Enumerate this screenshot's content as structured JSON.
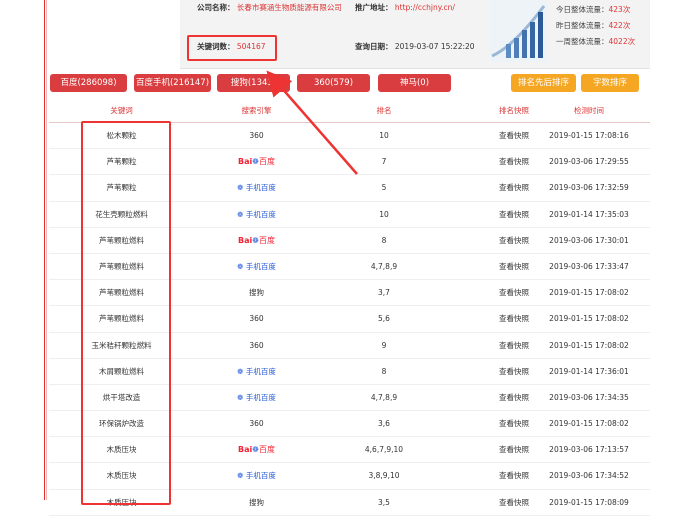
{
  "header": {
    "company_label": "公司名称：",
    "company_value": "长春市赛涵生物质能源有限公司",
    "promo_label": "推广地址：",
    "promo_value": "http://cchjny.cn/",
    "keywords_label": "关键词数：",
    "keywords_value": "504167",
    "query_label": "查询日期：",
    "query_value": "2019-03-07 15:22:20"
  },
  "stats": [
    {
      "label": "今日整体流量：",
      "value": "423次"
    },
    {
      "label": "昨日整体流量：",
      "value": "422次"
    },
    {
      "label": "一周整体流量：",
      "value": "4022次"
    }
  ],
  "tabs": [
    {
      "label": "百度(286098)"
    },
    {
      "label": "百度手机(216147)"
    },
    {
      "label": "搜狗(1343)"
    },
    {
      "label": "360(579)"
    },
    {
      "label": "神马(0)"
    }
  ],
  "sort_buttons": [
    {
      "label": "排名先后排序"
    },
    {
      "label": "字数排序"
    }
  ],
  "table": {
    "headers": [
      "关键词",
      "搜索引擎",
      "排名",
      "排名快照",
      "检测时间"
    ],
    "rows": [
      {
        "keyword": "松木颗粒",
        "engine": "360",
        "rank": "10",
        "snapshot": "查看快照",
        "time": "2019-01-15 17:08:16"
      },
      {
        "keyword": "芦苇颗粒",
        "engine": "百度",
        "rank": "7",
        "snapshot": "查看快照",
        "time": "2019-03-06 17:29:55"
      },
      {
        "keyword": "芦苇颗粒",
        "engine": "手机百度",
        "rank": "5",
        "snapshot": "查看快照",
        "time": "2019-03-06 17:32:59"
      },
      {
        "keyword": "花生壳颗粒燃料",
        "engine": "手机百度",
        "rank": "10",
        "snapshot": "查看快照",
        "time": "2019-01-14 17:35:03"
      },
      {
        "keyword": "芦苇颗粒燃料",
        "engine": "百度",
        "rank": "8",
        "snapshot": "查看快照",
        "time": "2019-03-06 17:30:01"
      },
      {
        "keyword": "芦苇颗粒燃料",
        "engine": "手机百度",
        "rank": "4,7,8,9",
        "snapshot": "查看快照",
        "time": "2019-03-06 17:33:47"
      },
      {
        "keyword": "芦苇颗粒燃料",
        "engine": "搜狗",
        "rank": "3,7",
        "snapshot": "查看快照",
        "time": "2019-01-15 17:08:02"
      },
      {
        "keyword": "芦苇颗粒燃料",
        "engine": "360",
        "rank": "5,6",
        "snapshot": "查看快照",
        "time": "2019-01-15 17:08:02"
      },
      {
        "keyword": "玉米秸秆颗粒燃料",
        "engine": "360",
        "rank": "9",
        "snapshot": "查看快照",
        "time": "2019-01-15 17:08:02"
      },
      {
        "keyword": "木屑颗粒燃料",
        "engine": "手机百度",
        "rank": "8",
        "snapshot": "查看快照",
        "time": "2019-01-14 17:36:01"
      },
      {
        "keyword": "烘干塔改造",
        "engine": "手机百度",
        "rank": "4,7,8,9",
        "snapshot": "查看快照",
        "time": "2019-03-06 17:34:35"
      },
      {
        "keyword": "环保锅炉改造",
        "engine": "360",
        "rank": "3,6",
        "snapshot": "查看快照",
        "time": "2019-01-15 17:08:02"
      },
      {
        "keyword": "木质压块",
        "engine": "百度",
        "rank": "4,6,7,9,10",
        "snapshot": "查看快照",
        "time": "2019-03-06 17:13:57"
      },
      {
        "keyword": "木质压块",
        "engine": "手机百度",
        "rank": "3,8,9,10",
        "snapshot": "查看快照",
        "time": "2019-03-06 17:34:52"
      },
      {
        "keyword": "木质压块",
        "engine": "搜狗",
        "rank": "3,5",
        "snapshot": "查看快照",
        "time": "2019-01-15 17:08:09"
      }
    ]
  },
  "colors": {
    "accent": "#d93d3f",
    "sort": "#f5a622",
    "link": "#2a5bd7"
  }
}
